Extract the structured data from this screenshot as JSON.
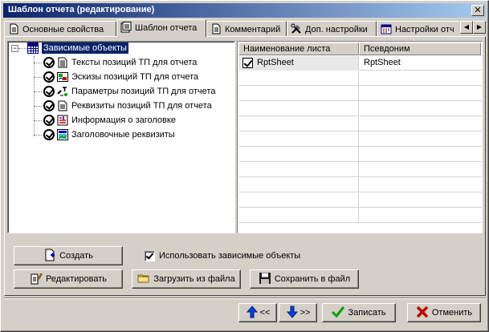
{
  "window": {
    "title": "Шаблон отчета (редактирование)",
    "close_glyph": "✕"
  },
  "tabs": [
    {
      "label": "Основные свойства",
      "icon": "document-icon",
      "active": false
    },
    {
      "label": "Шаблон отчета",
      "icon": "template-icon",
      "active": true
    },
    {
      "label": "Комментарий",
      "icon": "comment-icon",
      "active": false
    },
    {
      "label": "Доп. настройки",
      "icon": "tools-icon",
      "active": false
    },
    {
      "label": "Настройки отч",
      "icon": "calendar-icon",
      "active": false
    }
  ],
  "tab_scroll": {
    "left": "◀",
    "right": "▶"
  },
  "tree": {
    "expander": "−",
    "root": "Зависимые объекты",
    "items": [
      {
        "label": "Тексты позиций ТП для отчета",
        "icon": "text-doc-icon"
      },
      {
        "label": "Эскизы позиций ТП для отчета",
        "icon": "sketch-icon"
      },
      {
        "label": "Параметры позиций ТП для отчета",
        "icon": "parameters-icon"
      },
      {
        "label": "Реквизиты позиций ТП для отчета",
        "icon": "requisites-icon"
      },
      {
        "label": "Информация о заголовке",
        "icon": "header-info-icon"
      },
      {
        "label": "Заголовочные реквизиты",
        "icon": "header-requisites-icon"
      }
    ]
  },
  "grid": {
    "columns": [
      "Наименование листа",
      "Псевдоним"
    ],
    "rows": [
      {
        "name": "RptSheet",
        "alias": "RptSheet",
        "checked": true
      }
    ]
  },
  "buttons": {
    "create": "Создать",
    "edit": "Редактировать",
    "load": "Загрузить из файла",
    "save_file": "Сохранить в файл",
    "prev": "<<",
    "next": ">>",
    "save": "Записать",
    "cancel": "Отменить"
  },
  "checkbox": {
    "label": "Использовать зависимые объекты",
    "checked": true
  },
  "colors": {
    "title_start": "#0a246a",
    "title_end": "#a6caf0",
    "face": "#d4d0c8",
    "selection": "#0a246a"
  }
}
